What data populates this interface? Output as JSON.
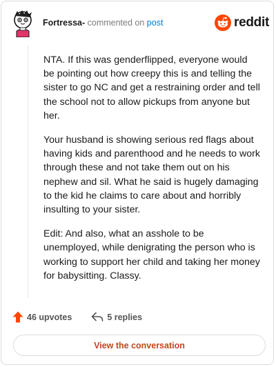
{
  "header": {
    "author": "Fortressa-",
    "action_text": "commented on",
    "post_link": "post",
    "brand": "reddit"
  },
  "comment": {
    "paragraphs": [
      "NTA. If this was genderflipped, everyone would be pointing out how creepy this is and telling the sister to go NC and get a restraining order and tell the school not to allow pickups from anyone but her.",
      "Your husband is showing serious red flags about having kids and parenthood and he needs to work through these and not take them out on his nephew and sil. What he said is hugely damaging to the kid he claims to care about and horribly insulting to your sister.",
      "Edit: And also, what an asshole to be unemployed, while denigrating the person who is working to support her child and taking her money for babysitting. Classy."
    ]
  },
  "stats": {
    "upvotes": "46 upvotes",
    "replies": "5 replies"
  },
  "cta": {
    "label": "View the conversation"
  },
  "colors": {
    "upvote": "#ff4500",
    "link": "#0079d3",
    "cta_text": "#c4451a",
    "brand": "#ff4500"
  },
  "icons": [
    "avatar",
    "reddit-logo-icon",
    "upvote-arrow-icon",
    "reply-arrow-icon"
  ]
}
